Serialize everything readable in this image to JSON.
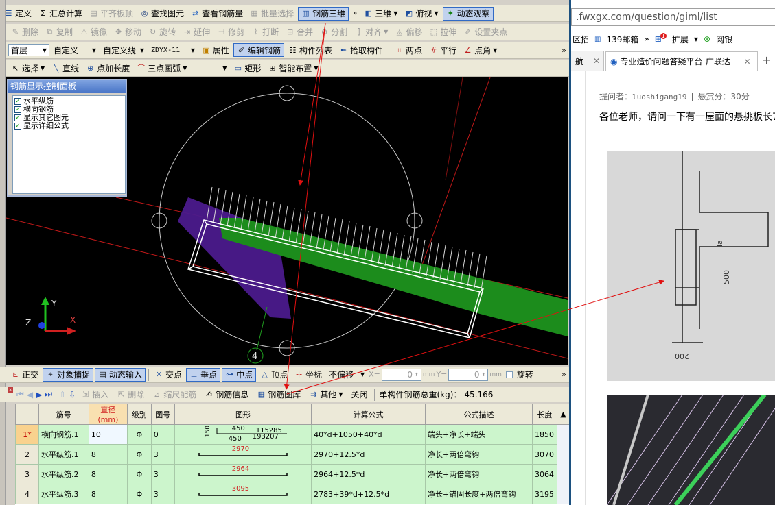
{
  "toolbar1": {
    "define": "定义",
    "summary_calc": "汇总计算",
    "flat_slab_top": "平齐板顶",
    "find_element": "查找图元",
    "view_rebar_qty": "查看钢筋量",
    "batch_select": "批量选择",
    "rebar_3d": "钢筋三维",
    "view_3d": "三维",
    "top_view": "俯视",
    "dynamic_observe": "动态观察"
  },
  "toolbar2": {
    "delete": "删除",
    "copy": "复制",
    "mirror": "镜像",
    "move": "移动",
    "rotate": "旋转",
    "extend": "延伸",
    "trim": "修剪",
    "break": "打断",
    "merge": "合并",
    "split": "分割",
    "align": "对齐",
    "offset": "偏移",
    "stretch": "拉伸",
    "set_pin": "设置夹点"
  },
  "toolbar3": {
    "floor": "首层",
    "custom": "自定义",
    "custom_line": "自定义线",
    "code": "ZDYX-11",
    "properties": "属性",
    "edit_rebar": "编辑钢筋",
    "element_list": "构件列表",
    "pick_element": "拾取构件",
    "two_points": "两点",
    "parallel": "平行",
    "point_angle": "点角"
  },
  "toolbar4": {
    "select": "选择",
    "line": "直线",
    "point_length": "点加长度",
    "three_point_arc": "三点画弧",
    "rect": "矩形",
    "smart_layout": "智能布置"
  },
  "control_panel": {
    "title": "钢筋显示控制面板",
    "items": [
      "水平纵筋",
      "横向钢筋",
      "显示其它图元",
      "显示详细公式"
    ]
  },
  "viewport": {
    "axis_x": "X",
    "axis_y": "Y",
    "axis_z": "Z",
    "grid_label": "4"
  },
  "snapbar": {
    "ortho": "正交",
    "object_snap": "对象捕捉",
    "dynamic_input": "动态输入",
    "intersection": "交点",
    "perpendicular": "垂点",
    "midpoint": "中点",
    "vertex": "顶点",
    "coordinate": "坐标",
    "offset_mode": "不偏移",
    "x_label": "X=",
    "x_value": "0",
    "y_label": "Y=",
    "y_value": "0",
    "unit": "mm",
    "rotate": "旋转"
  },
  "gridbar": {
    "insert": "插入",
    "delete": "删除",
    "scale_rebar": "缩尺配筋",
    "rebar_info": "钢筋信息",
    "rebar_library": "钢筋图库",
    "other": "其他",
    "close": "关闭",
    "total_weight_label": "单构件钢筋总重(kg)：",
    "total_weight": "45.166"
  },
  "grid": {
    "headers": [
      "筋号",
      "直径(mm)",
      "级别",
      "图号",
      "图形",
      "计算公式",
      "公式描述",
      "长度"
    ],
    "rows": [
      {
        "idx": "1*",
        "name": "横向钢筋.1",
        "dia": "10",
        "grade": "Φ",
        "fig": "0",
        "formula": "40*d+1050+40*d",
        "desc": "端头+净长+端头",
        "len": "1850",
        "shape_top_left": "150",
        "shape_top_mid": "450",
        "shape_top_right": "115285",
        "shape_bot_mid": "450",
        "shape_bot_right": "193207"
      },
      {
        "idx": "2",
        "name": "水平纵筋.1",
        "dia": "8",
        "grade": "Φ",
        "fig": "3",
        "formula": "2970+12.5*d",
        "desc": "净长+两倍弯钩",
        "len": "3070",
        "shape": "2970"
      },
      {
        "idx": "3",
        "name": "水平纵筋.2",
        "dia": "8",
        "grade": "Φ",
        "fig": "3",
        "formula": "2964+12.5*d",
        "desc": "净长+两倍弯钩",
        "len": "3064",
        "shape": "2964"
      },
      {
        "idx": "4",
        "name": "水平纵筋.3",
        "dia": "8",
        "grade": "Φ",
        "fig": "3",
        "formula": "2783+39*d+12.5*d",
        "desc": "净长+锚固长度+两倍弯钩",
        "len": "3195",
        "shape": "3095"
      }
    ]
  },
  "browser": {
    "url": ".fwxgx.com/question/giml/list",
    "bookmark1": "区招",
    "bookmark2": "139邮箱",
    "ext": "扩展",
    "ext_badge": "1",
    "netbank": "网银",
    "tab1": "航",
    "tab2": "专业造价问题答疑平台-广联达",
    "asker_label": "提问者：",
    "asker": "luoshigang19",
    "reward": "悬赏分：30分",
    "question": "各位老师，请问一下有一屋面的悬挑板长7"
  },
  "colors": {
    "accent": "#316ac5",
    "grid_bg": "#ccf5cc",
    "rebar_green": "#1c8c1c",
    "panel_purple": "#4b1a8c",
    "annotation_red": "#e01010"
  }
}
